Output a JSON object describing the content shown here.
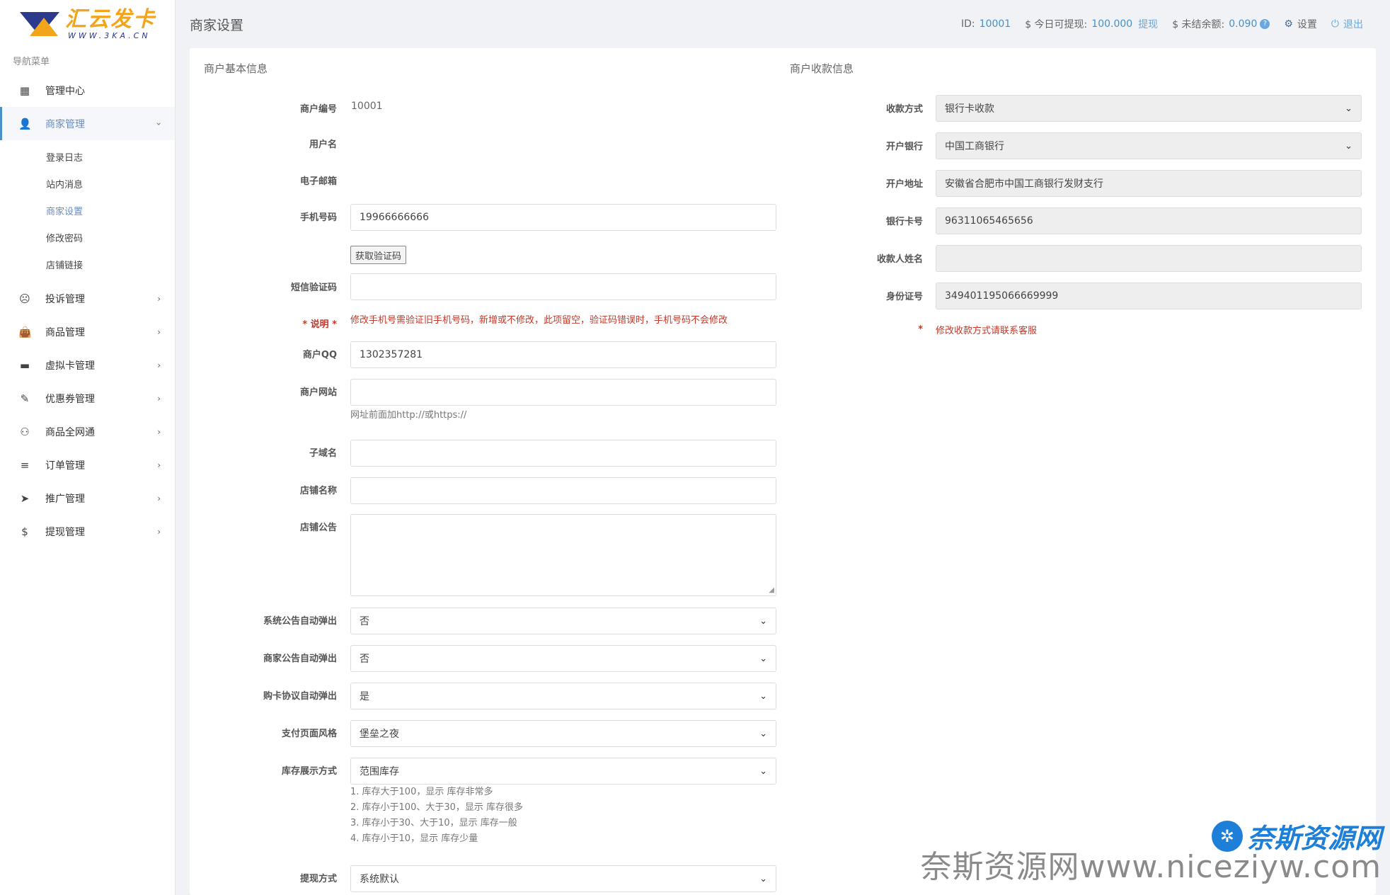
{
  "logo": {
    "title": "汇云发卡",
    "sub": "WWW.3KA.CN"
  },
  "sidebar": {
    "heading": "导航菜单",
    "items": [
      {
        "label": "管理中心",
        "icon": "dashboard-icon",
        "glyph": "▦"
      },
      {
        "label": "商家管理",
        "icon": "user-icon",
        "glyph": "👤"
      },
      {
        "label": "投诉管理",
        "icon": "frown-icon",
        "glyph": "☹"
      },
      {
        "label": "商品管理",
        "icon": "bag-icon",
        "glyph": "👜"
      },
      {
        "label": "虚拟卡管理",
        "icon": "card-icon",
        "glyph": "▬"
      },
      {
        "label": "优惠券管理",
        "icon": "ticket-icon",
        "glyph": "✎"
      },
      {
        "label": "商品全网通",
        "icon": "handshake-icon",
        "glyph": "⚇"
      },
      {
        "label": "订单管理",
        "icon": "list-icon",
        "glyph": "≡"
      },
      {
        "label": "推广管理",
        "icon": "send-icon",
        "glyph": "➤"
      },
      {
        "label": "提现管理",
        "icon": "dollar-icon",
        "glyph": "$"
      }
    ],
    "sub_items": [
      "登录日志",
      "站内消息",
      "商家设置",
      "修改密码",
      "店铺链接"
    ],
    "chevron": "›"
  },
  "topbar": {
    "title": "商家设置",
    "id_label": "ID:",
    "id_value": "10001",
    "withdrawable_label": "$ 今日可提现:",
    "withdrawable_value": "100.000",
    "withdraw_link": "提现",
    "unsettled_label": "$ 未结余额:",
    "unsettled_value": "0.090",
    "question": "?",
    "settings": "设置",
    "settings_glyph": "⚙",
    "logout": "退出",
    "logout_glyph": "⏻"
  },
  "basic": {
    "title": "商户基本信息",
    "merchant_no_label": "商户编号",
    "merchant_no": "10001",
    "username_label": "用户名",
    "email_label": "电子邮箱",
    "phone_label": "手机号码",
    "phone": "19966666666",
    "get_code": "获取验证码",
    "sms_label": "短信验证码",
    "note_label": "* 说明 *",
    "note": "修改手机号需验证旧手机号码，新增或不修改，此项留空，验证码错误时，手机号码不会修改",
    "qq_label": "商户QQ",
    "qq": "1302357281",
    "site_label": "商户网站",
    "site_help": "网址前面加http://或https://",
    "subdomain_label": "子域名",
    "shopname_label": "店铺名称",
    "notice_label": "店铺公告",
    "sys_popup_label": "系统公告自动弹出",
    "sys_popup": "否",
    "shop_popup_label": "商家公告自动弹出",
    "shop_popup": "否",
    "agreement_popup_label": "购卡协议自动弹出",
    "agreement_popup": "是",
    "pay_style_label": "支付页面风格",
    "pay_style": "堡垒之夜",
    "stock_label": "库存展示方式",
    "stock": "范围库存",
    "stock_help": [
      "1. 库存大于100，显示 库存非常多",
      "2. 库存小于100、大于30，显示 库存很多",
      "3. 库存小于30、大于10，显示 库存一般",
      "4. 库存小于10，显示 库存少量"
    ],
    "withdraw_label": "提现方式",
    "withdraw": "系统默认"
  },
  "payee": {
    "title": "商户收款信息",
    "method_label": "收款方式",
    "method": "银行卡收款",
    "bank_label": "开户银行",
    "bank": "中国工商银行",
    "address_label": "开户地址",
    "address": "安徽省合肥市中国工商银行发财支行",
    "card_label": "银行卡号",
    "card": "96311065465656",
    "name_label": "收款人姓名",
    "name": "",
    "id_label": "身份证号",
    "id_no": "349401195066669999",
    "star": "*",
    "note": "修改收款方式请联系客服"
  },
  "caret": "⌄",
  "watermark": {
    "logo_glyph": "✲",
    "name": "奈斯资源网",
    "text": "奈斯资源网www.niceziyw.com"
  }
}
